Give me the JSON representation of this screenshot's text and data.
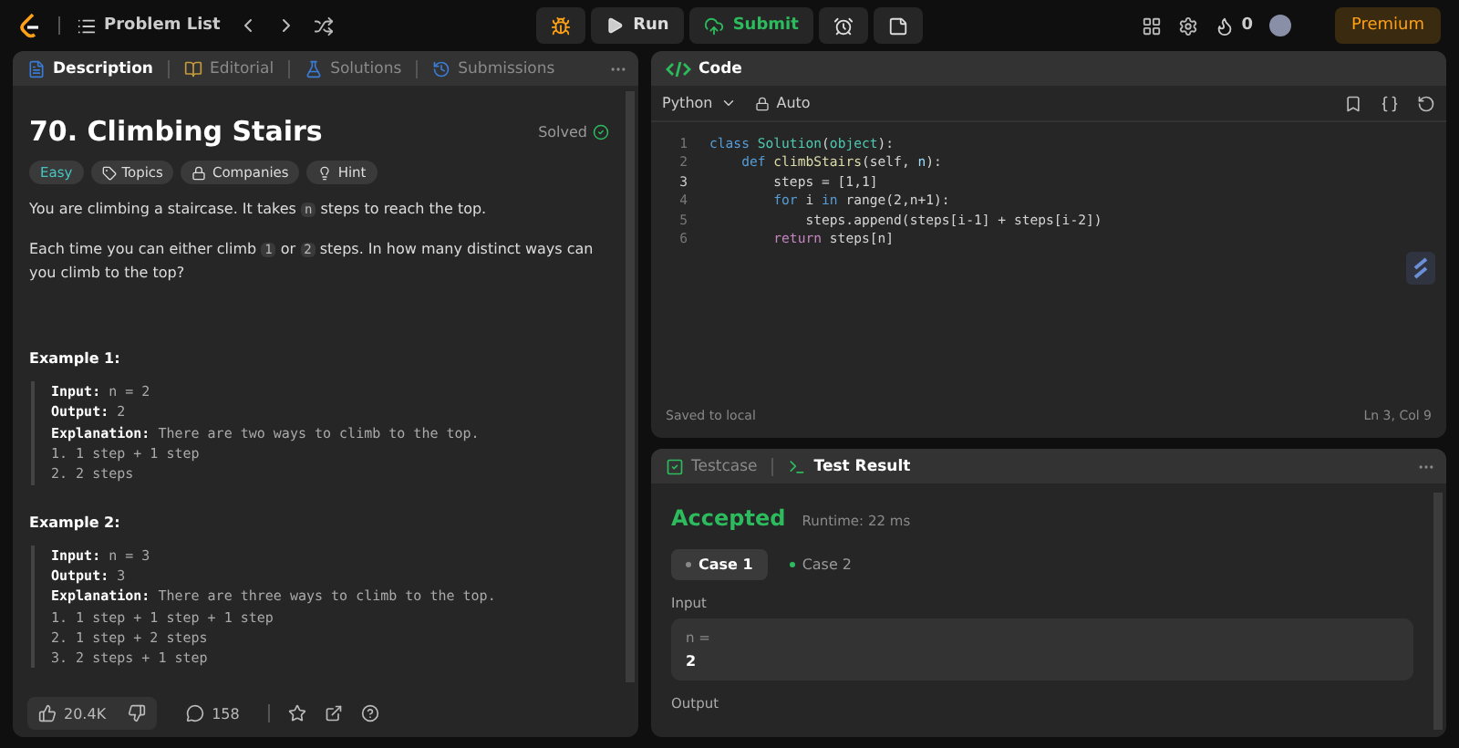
{
  "topbar": {
    "nav_title": "Problem List",
    "run_label": "Run",
    "submit_label": "Submit",
    "streak": "0",
    "premium_label": "Premium"
  },
  "description_panel": {
    "tabs": [
      {
        "label": "Description",
        "selected": true
      },
      {
        "label": "Editorial",
        "selected": false
      },
      {
        "label": "Solutions",
        "selected": false
      },
      {
        "label": "Submissions",
        "selected": false
      }
    ],
    "title": "70. Climbing Stairs",
    "status": "Solved",
    "tags": [
      {
        "label": "Easy",
        "kind": "difficulty"
      },
      {
        "label": "Topics",
        "kind": "tag"
      },
      {
        "label": "Companies",
        "kind": "lock"
      },
      {
        "label": "Hint",
        "kind": "bulb"
      }
    ],
    "paragraphs": [
      [
        {
          "kind": "text",
          "text": "You are climbing a staircase. It takes "
        },
        {
          "kind": "code",
          "text": "n"
        },
        {
          "kind": "text",
          "text": " steps to reach the top."
        }
      ],
      [
        {
          "kind": "text",
          "text": "Each time you can either climb "
        },
        {
          "kind": "code",
          "text": "1"
        },
        {
          "kind": "text",
          "text": " or "
        },
        {
          "kind": "code",
          "text": "2"
        },
        {
          "kind": "text",
          "text": " steps. In how many distinct ways can you climb to the top?"
        }
      ]
    ],
    "examples": [
      {
        "heading": "Example 1:",
        "lines": [
          "**Input:** n = 2",
          "**Output:** 2",
          "**Explanation:** There are two ways to climb to the top.",
          "1. 1 step + 1 step",
          "2. 2 steps"
        ]
      },
      {
        "heading": "Example 2:",
        "lines": [
          "**Input:** n = 3",
          "**Output:** 3",
          "**Explanation:** There are three ways to climb to the top.",
          "1. 1 step + 1 step + 1 step",
          "2. 1 step + 2 steps",
          "3. 2 steps + 1 step"
        ]
      }
    ],
    "footer": {
      "likes": "20.4K",
      "comments": "158"
    }
  },
  "code_panel": {
    "tab": "Code",
    "language": "Python",
    "mode": "Auto",
    "status": "Saved to local",
    "cursor": "Ln 3, Col 9",
    "lines": [
      {
        "number": "1",
        "tokens": [
          {
            "kind": "keyword",
            "text": "class "
          },
          {
            "kind": "type",
            "text": "Solution"
          },
          {
            "kind": "plain",
            "text": "("
          },
          {
            "kind": "type",
            "text": "object"
          },
          {
            "kind": "plain",
            "text": "):"
          }
        ]
      },
      {
        "number": "2",
        "tokens": [
          {
            "kind": "keyword",
            "text": "    def "
          },
          {
            "kind": "func",
            "text": "climbStairs"
          },
          {
            "kind": "plain",
            "text": "(self, "
          },
          {
            "kind": "param",
            "text": "n"
          },
          {
            "kind": "plain",
            "text": "):"
          }
        ]
      },
      {
        "number": "3",
        "tokens": [
          {
            "kind": "plain",
            "text": "        steps = [1,1]"
          }
        ]
      },
      {
        "number": "4",
        "tokens": [
          {
            "kind": "keyword",
            "text": "        for "
          },
          {
            "kind": "plain",
            "text": "i "
          },
          {
            "kind": "keyword",
            "text": "in "
          },
          {
            "kind": "plain",
            "text": "range(2,n+1):"
          }
        ]
      },
      {
        "number": "5",
        "tokens": [
          {
            "kind": "plain",
            "text": "            steps.append(steps[i-1] + steps[i-2])"
          }
        ]
      },
      {
        "number": "6",
        "tokens": [
          {
            "kind": "control",
            "text": "        return "
          },
          {
            "kind": "plain",
            "text": "steps[n]"
          }
        ]
      }
    ]
  },
  "result_panel": {
    "tabs": [
      {
        "label": "Testcase",
        "selected": false
      },
      {
        "label": "Test Result",
        "selected": true
      }
    ],
    "verdict": "Accepted",
    "runtime": "Runtime: 22 ms",
    "cases": [
      {
        "label": "Case 1",
        "selected": true
      },
      {
        "label": "Case 2",
        "selected": false
      }
    ],
    "input_label": "Input",
    "param": "n =",
    "value": "2",
    "output_label": "Output"
  }
}
